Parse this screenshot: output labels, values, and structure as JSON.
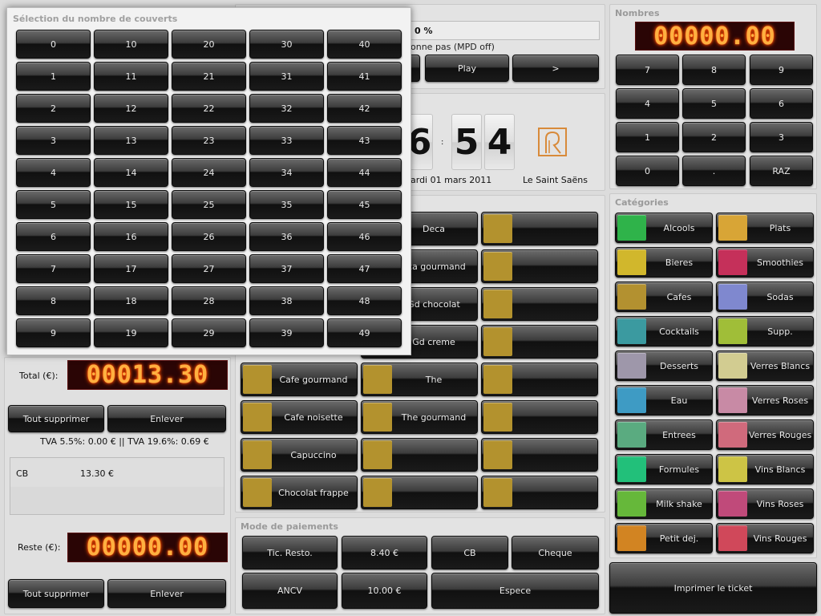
{
  "colors": {
    "panel_bg": "#e3e3e3",
    "button_dark": "#1a1a1a",
    "led_text": "#ffb040",
    "led_bg": "#2a0505",
    "logo": "#d88a3a"
  },
  "top_panel": {
    "percent_value": "0 %",
    "mpd_text": "onne pas (MPD off)",
    "play_label": "Play",
    "next_label": ">"
  },
  "clock": {
    "digit_partial": "6",
    "separator": ":",
    "minute_tens": "5",
    "minute_units": "4",
    "date_text": "ardi 01 mars 2011",
    "shop_name": "Le Saint Saëns",
    "logo_icon": "restaurant-logo-icon"
  },
  "nombres": {
    "title": "Nombres",
    "display": "00000.00",
    "keys": [
      "7",
      "8",
      "9",
      "4",
      "5",
      "6",
      "1",
      "2",
      "3",
      "0",
      ".",
      "RAZ"
    ]
  },
  "categories": {
    "title": "Catégories",
    "items": [
      {
        "label": "Alcools",
        "color": "#2fb34a"
      },
      {
        "label": "Plats",
        "color": "#d8a536"
      },
      {
        "label": "Bieres",
        "color": "#d1b72c"
      },
      {
        "label": "Smoothies",
        "color": "#c5305a"
      },
      {
        "label": "Cafes",
        "color": "#b39130"
      },
      {
        "label": "Sodas",
        "color": "#7f88cf"
      },
      {
        "label": "Cocktails",
        "color": "#3b9aa0"
      },
      {
        "label": "Supp.",
        "color": "#a0be38"
      },
      {
        "label": "Desserts",
        "color": "#9e97aa"
      },
      {
        "label": "Verres Blancs",
        "color": "#d2cc91"
      },
      {
        "label": "Eau",
        "color": "#3e9bc4"
      },
      {
        "label": "Verres Roses",
        "color": "#c88aa5"
      },
      {
        "label": "Entrees",
        "color": "#5aab80"
      },
      {
        "label": "Verres Rouges",
        "color": "#d06a7c"
      },
      {
        "label": "Formules",
        "color": "#22c07a"
      },
      {
        "label": "Vins Blancs",
        "color": "#cdc445"
      },
      {
        "label": "Milk shake",
        "color": "#66b83a"
      },
      {
        "label": "Vins Roses",
        "color": "#c04a7a"
      },
      {
        "label": "Petit dej.",
        "color": "#d28422"
      },
      {
        "label": "Vins Rouges",
        "color": "#d0485a"
      }
    ]
  },
  "products": {
    "swatch_color": "#b3922e",
    "col2": [
      "Deca",
      "eca gourmand",
      "Gd chocolat",
      "Gd creme",
      "The",
      "The gourmand",
      "",
      ""
    ],
    "col1": [
      "Cafe gourmand",
      "Cafe noisette",
      "Capuccino",
      "Chocolat frappe"
    ]
  },
  "left": {
    "total_label": "Total (€):",
    "total_display": "00013.30",
    "tout_supprimer": "Tout supprimer",
    "enlever": "Enlever",
    "tva_text": "TVA 5.5%:  0.00 € || TVA 19.6%:  0.69 €",
    "payment_method": "CB",
    "payment_amount": "13.30 €",
    "reste_label": "Reste (€):",
    "reste_display": "00000.00",
    "tout_supprimer2": "Tout supprimer",
    "enlever2": "Enlever"
  },
  "payments": {
    "title": "Mode de paiements",
    "row1": [
      "Tic. Resto.",
      "8.40 €",
      "CB",
      "Cheque"
    ],
    "row2": [
      "ANCV",
      "10.00 €",
      "Espece"
    ]
  },
  "print_label": "Imprimer le ticket",
  "modal": {
    "title": "Sélection du nombre de couverts",
    "numbers": [
      "0",
      "10",
      "20",
      "30",
      "40",
      "1",
      "11",
      "21",
      "31",
      "41",
      "2",
      "12",
      "22",
      "32",
      "42",
      "3",
      "13",
      "23",
      "33",
      "43",
      "4",
      "14",
      "24",
      "34",
      "44",
      "5",
      "15",
      "25",
      "35",
      "45",
      "6",
      "16",
      "26",
      "36",
      "46",
      "7",
      "17",
      "27",
      "37",
      "47",
      "8",
      "18",
      "28",
      "38",
      "48",
      "9",
      "19",
      "29",
      "39",
      "49"
    ]
  }
}
